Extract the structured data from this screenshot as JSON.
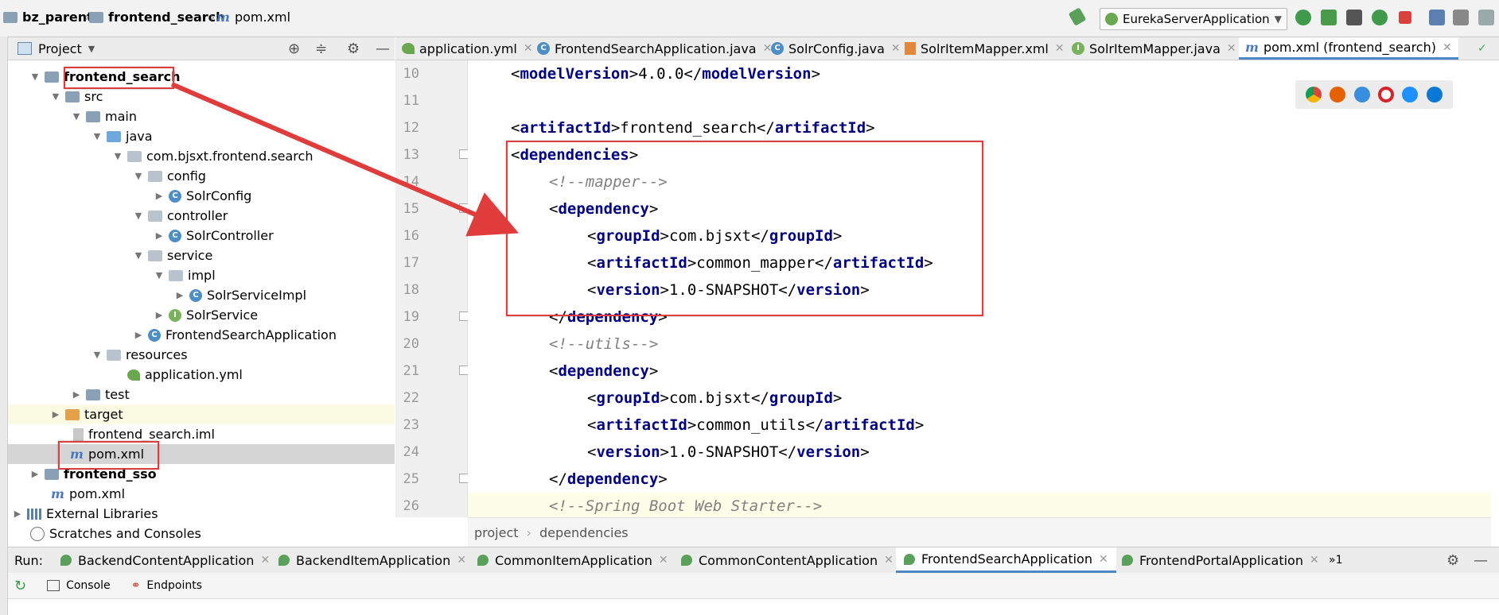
{
  "navbar": {
    "crumbs": [
      "bz_parent",
      "frontend_search",
      "pom.xml"
    ],
    "run_config": "EurekaServerApplication"
  },
  "project_panel": {
    "title": "Project",
    "tree": [
      {
        "label": "frontend_search",
        "bold": true,
        "depth": 2
      },
      {
        "label": "src",
        "depth": 3
      },
      {
        "label": "main",
        "depth": 4
      },
      {
        "label": "java",
        "depth": 5
      },
      {
        "label": "com.bjsxt.frontend.search",
        "depth": 6
      },
      {
        "label": "config",
        "depth": 7
      },
      {
        "label": "SolrConfig",
        "depth": 8
      },
      {
        "label": "controller",
        "depth": 7
      },
      {
        "label": "SolrController",
        "depth": 8
      },
      {
        "label": "service",
        "depth": 7
      },
      {
        "label": "impl",
        "depth": 8
      },
      {
        "label": "SolrServiceImpl",
        "depth": 9
      },
      {
        "label": "SolrService",
        "depth": 8
      },
      {
        "label": "FrontendSearchApplication",
        "depth": 7
      },
      {
        "label": "resources",
        "depth": 5
      },
      {
        "label": "application.yml",
        "depth": 6
      },
      {
        "label": "test",
        "depth": 4
      },
      {
        "label": "target",
        "depth": 3
      },
      {
        "label": "frontend_search.iml",
        "depth": 3
      },
      {
        "label": "pom.xml",
        "depth": 3
      },
      {
        "label": "frontend_sso",
        "bold": true,
        "depth": 2
      },
      {
        "label": "pom.xml",
        "depth": 2
      },
      {
        "label": "External Libraries",
        "depth": 1
      },
      {
        "label": "Scratches and Consoles",
        "depth": 1
      }
    ]
  },
  "editor_tabs": [
    "application.yml",
    "FrontendSearchApplication.java",
    "SolrConfig.java",
    "SolrItemMapper.xml",
    "SolrItemMapper.java",
    "pom.xml (frontend_search)"
  ],
  "editor": {
    "line_numbers": [
      "10",
      "11",
      "12",
      "13",
      "14",
      "15",
      "16",
      "17",
      "18",
      "19",
      "20",
      "21",
      "22",
      "23",
      "24",
      "25",
      "26"
    ],
    "breadcrumb": [
      "project",
      "dependencies"
    ],
    "code": {
      "l10_tag": "modelVersion",
      "l10_val": "4.0.0",
      "l12_tag": "artifactId",
      "l12_val": "frontend_search",
      "l13_tag": "dependencies",
      "l14": "<!--mapper-->",
      "dep": "dependency",
      "g": "groupId",
      "a": "artifactId",
      "v": "version",
      "gval": "com.bjsxt",
      "a1val": "common_mapper",
      "vval": "1.0-SNAPSHOT",
      "l20": "<!--utils-->",
      "a2val": "common_utils",
      "l26": "<!--Spring Boot Web Starter-->"
    }
  },
  "run_panel": {
    "label": "Run:",
    "tabs": [
      "BackendContentApplication",
      "BackendItemApplication",
      "CommonItemApplication",
      "CommonContentApplication",
      "FrontendSearchApplication",
      "FrontendPortalApplication"
    ],
    "overflow": "»1",
    "console_tabs": [
      "Console",
      "Endpoints"
    ]
  },
  "colors": {
    "accent": "#4a88c7",
    "annotation": "#e03c3c"
  }
}
